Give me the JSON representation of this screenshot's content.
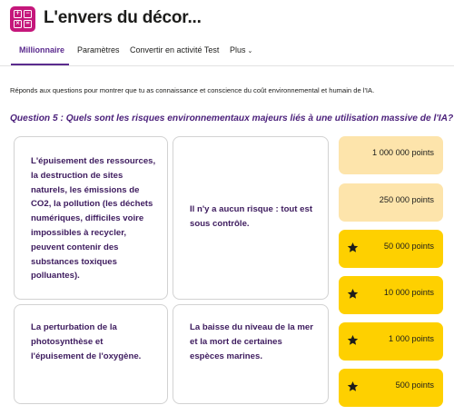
{
  "app": {
    "title": "L'envers du décor...",
    "icon_name": "calculator-app-icon",
    "brand_color": "#c5177b"
  },
  "tabs": [
    {
      "label": "Millionnaire",
      "active": true
    },
    {
      "label": "Paramètres",
      "active": false
    },
    {
      "label": "Convertir en activité Test",
      "active": false
    },
    {
      "label": "Plus",
      "active": false,
      "icon": "chevron-down-icon"
    }
  ],
  "instruction": "Réponds aux questions pour montrer que tu as connaissance et conscience du coût environnemental et humain de l'IA.",
  "question": "Question 5 : Quels sont les risques environnementaux majeurs liés à une utilisation massive de l'IA?",
  "answers": [
    "L'épuisement des ressources, la destruction de sites naturels, les émissions de CO2, la pollution (les déchets numériques, difficiles voire impossibles à recycler, peuvent contenir des substances toxiques polluantes).",
    "Il n'y a aucun risque : tout est sous contrôle.",
    "La perturbation de la photosynthèse et l'épuisement de l'oxygène.",
    "La baisse du niveau de la mer et la mort de certaines espèces marines."
  ],
  "ladder": [
    {
      "points": "1 000 000 points",
      "state": "pending",
      "icon": null
    },
    {
      "points": "250 000 points",
      "state": "pending",
      "icon": null
    },
    {
      "points": "50 000 points",
      "state": "reached",
      "icon": "star-icon"
    },
    {
      "points": "10 000 points",
      "state": "reached",
      "icon": "star-icon"
    },
    {
      "points": "1 000 points",
      "state": "reached",
      "icon": "star-icon"
    },
    {
      "points": "500 points",
      "state": "reached",
      "icon": "star-icon"
    }
  ],
  "colors": {
    "accent": "#5b2b8e",
    "question": "#4a1f7a",
    "answer_text": "#3d1b5e",
    "ladder_pending": "#fde4ab",
    "ladder_reached": "#fed000"
  }
}
